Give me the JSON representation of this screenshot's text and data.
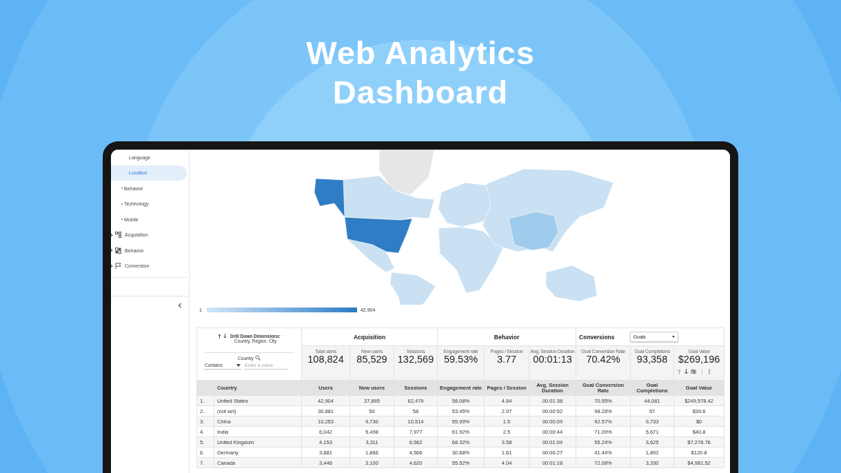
{
  "title": "Web Analytics Dashboard",
  "sidebar": {
    "items": [
      {
        "label": "Language",
        "kind": "sub",
        "selected": false
      },
      {
        "label": "Location",
        "kind": "sub",
        "selected": true
      },
      {
        "label": "Behavior",
        "kind": "bullet",
        "selected": false
      },
      {
        "label": "Technology",
        "kind": "bullet",
        "selected": false
      },
      {
        "label": "Mobile",
        "kind": "bullet",
        "selected": false
      },
      {
        "label": "Acquisition",
        "kind": "section",
        "selected": false
      },
      {
        "label": "Behavior",
        "kind": "section",
        "selected": false
      },
      {
        "label": "Conversion",
        "kind": "section",
        "selected": false
      }
    ]
  },
  "map": {
    "legend": {
      "min": "1",
      "max": "42,904"
    }
  },
  "table": {
    "drill_down": {
      "title": "Drill Down Dimensions:",
      "dimensions": "Country,  Region, City"
    },
    "filter": {
      "label": "Country",
      "operator": "Contains",
      "placeholder": "Enter a value"
    },
    "groups": [
      {
        "label": "Acquisition"
      },
      {
        "label": "Behavior"
      },
      {
        "label": "Conversions",
        "dropdown": "Goals"
      }
    ],
    "totals": [
      {
        "label": "Total users",
        "value": "108,824"
      },
      {
        "label": "New users",
        "value": "85,529"
      },
      {
        "label": "Sessions",
        "value": "132,569"
      },
      {
        "label": "Engagement rate",
        "value": "59.53%"
      },
      {
        "label": "Pages / Session",
        "value": "3.77"
      },
      {
        "label": "Avg. Session Duration",
        "value": "00:01:13"
      },
      {
        "label": "Goal Conversion Rate",
        "value": "70.42%"
      },
      {
        "label": "Goal Completions",
        "value": "93,358"
      },
      {
        "label": "Goal Value",
        "value": "$269,196"
      }
    ],
    "columns": [
      "Country",
      "Users",
      "New users",
      "Sessions",
      "Engagement rate",
      "Pages / Session",
      "Avg. Session Duration",
      "Goal Conversion Rate",
      "Goal Completions",
      "Goal Value"
    ],
    "rows": [
      {
        "rank": "1.",
        "cells": [
          "United States",
          "42,904",
          "37,895",
          "62,479",
          "58.08%",
          "4.84",
          "00:01:38",
          "70.55%",
          "44,081",
          "$249,578.42"
        ]
      },
      {
        "rank": "2.",
        "cells": [
          "(not set)",
          "30,881",
          "50",
          "58",
          "53.45%",
          "2.97",
          "00:00:52",
          "98.28%",
          "57",
          "$39.6"
        ]
      },
      {
        "rank": "3.",
        "cells": [
          "China",
          "10,253",
          "9,730",
          "10,514",
          "55.99%",
          "1.5",
          "00:00:09",
          "92.57%",
          "9,733",
          "$0"
        ]
      },
      {
        "rank": "4.",
        "cells": [
          "India",
          "6,042",
          "5,498",
          "7,977",
          "61.92%",
          "2.5",
          "00:00:44",
          "71.09%",
          "5,671",
          "$40.8"
        ]
      },
      {
        "rank": "5.",
        "cells": [
          "United Kingdom",
          "4,153",
          "3,311",
          "6,562",
          "68.32%",
          "3.58",
          "00:01:09",
          "55.24%",
          "3,625",
          "$7,276.76"
        ]
      },
      {
        "rank": "6.",
        "cells": [
          "Germany",
          "3,881",
          "1,866",
          "4,566",
          "30.68%",
          "1.61",
          "00:00:27",
          "41.44%",
          "1,892",
          "$120.8"
        ]
      },
      {
        "rank": "7.",
        "cells": [
          "Canada",
          "3,446",
          "3,100",
          "4,620",
          "55.52%",
          "4.04",
          "00:01:18",
          "72.08%",
          "3,330",
          "$4,981.52"
        ]
      }
    ]
  }
}
